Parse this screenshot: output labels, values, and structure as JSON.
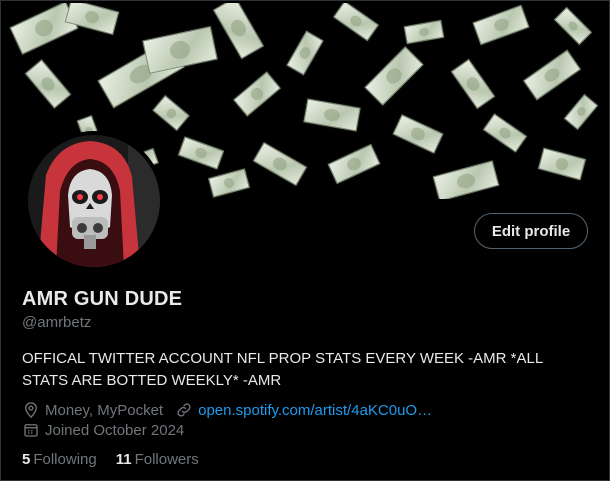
{
  "profile": {
    "name": "AMR GUN DUDE",
    "handle": "@amrbetz",
    "bio": "OFFICAL TWITTER ACCOUNT NFL PROP STATS EVERY WEEK -AMR *ALL STATS ARE BOTTED WEEKLY* -AMR",
    "location": "Money, MyPocket",
    "website": "open.spotify.com/artist/4aKC0uO…",
    "joined": "Joined October 2024",
    "following_count": "5",
    "following_label": "Following",
    "followers_count": "11",
    "followers_label": "Followers"
  },
  "actions": {
    "edit_profile": "Edit profile"
  },
  "icons": {
    "location": "location-pin-icon",
    "link": "link-icon",
    "calendar": "calendar-icon"
  },
  "colors": {
    "background": "#000000",
    "text": "#e7e9ea",
    "secondary_text": "#71767b",
    "link": "#1d9bf0",
    "button_border": "#536471",
    "avatar_hood": "#c8343c"
  }
}
